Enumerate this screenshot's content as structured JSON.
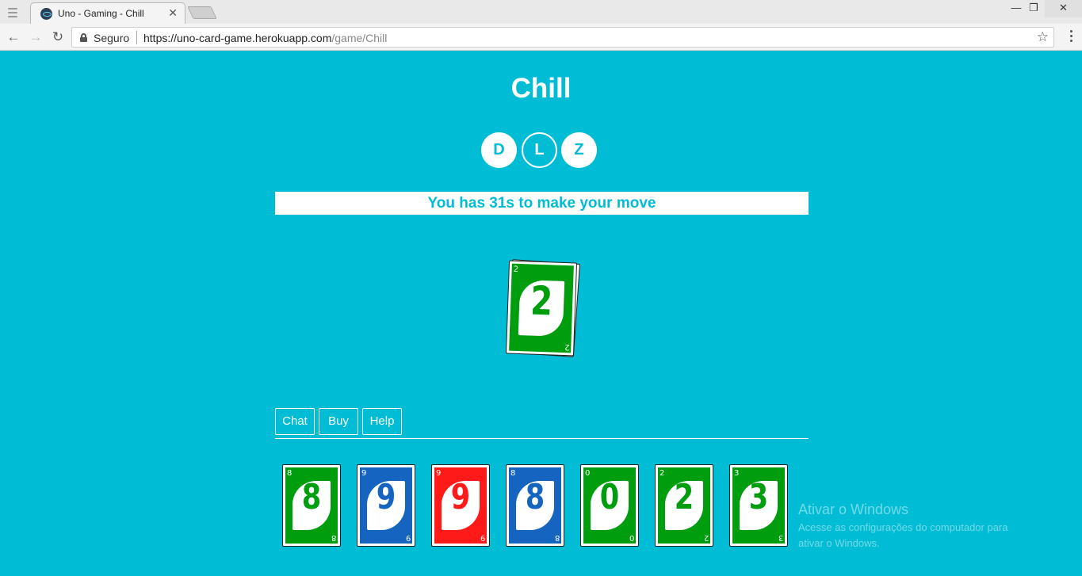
{
  "browser": {
    "tab_title": "Uno - Gaming - Chill",
    "secure_label": "Seguro",
    "url_host": "https://uno-card-game.herokuapp.com",
    "url_path": "/game/Chill"
  },
  "game": {
    "title": "Chill",
    "players": [
      {
        "initial": "D",
        "current": false
      },
      {
        "initial": "L",
        "current": true
      },
      {
        "initial": "Z",
        "current": false
      }
    ],
    "status": "You has 31s to make your move",
    "discard_top": {
      "value": "2",
      "color": "#009e0f"
    }
  },
  "actions": {
    "chat": "Chat",
    "buy": "Buy",
    "help": "Help"
  },
  "hand": [
    {
      "value": "8",
      "color": "#009e0f"
    },
    {
      "value": "9",
      "color": "#1565c0"
    },
    {
      "value": "9",
      "color": "#ff1a1a"
    },
    {
      "value": "8",
      "color": "#1565c0"
    },
    {
      "value": "0",
      "color": "#009e0f"
    },
    {
      "value": "2",
      "color": "#009e0f"
    },
    {
      "value": "3",
      "color": "#009e0f"
    }
  ],
  "watermark": {
    "title": "Ativar o Windows",
    "line1": "Acesse as configurações do computador para",
    "line2": "ativar o Windows."
  }
}
